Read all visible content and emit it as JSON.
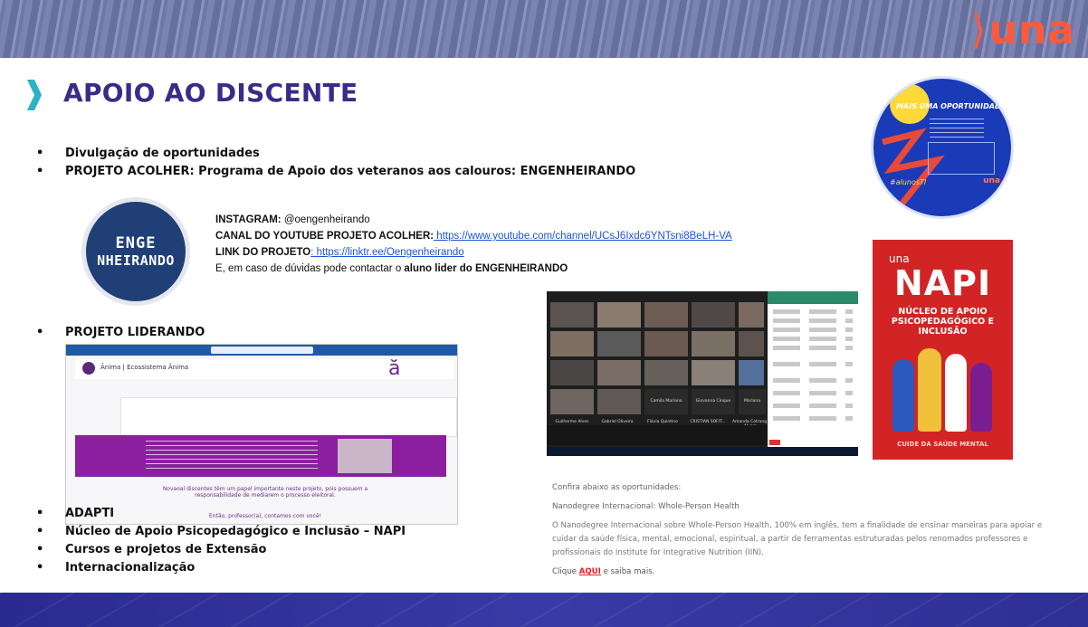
{
  "banner": {
    "logo_text": "una",
    "logo_accent": "#ff5a3c"
  },
  "title": {
    "text": "APOIO AO DISCENTE",
    "color": "#3b2a87"
  },
  "bullets_top": [
    "Divulgação de oportunidades",
    "PROJETO ACOLHER: Programa de Apoio dos veteranos aos calouros: ENGENHEIRANDO"
  ],
  "enge_logo": {
    "line1": "ENGE",
    "line2": "NHEIRANDO"
  },
  "info": {
    "instagram_label": "INSTAGRAM:",
    "instagram_value": " @oengenheirando",
    "youtube_label": "CANAL DO YOUTUBE PROJETO ACOLHER:",
    "youtube_link": " https://www.youtube.com/channel/UCsJ6Ixdc6YNTsni8BeLH-VA",
    "link_label": "LINK DO PROJETO",
    "link_value": ": https://linktr.ee/Oengenheirando",
    "contact_prefix": "E, em caso de dúvidas pode contactar o ",
    "contact_bold": "aluno lider do ENGENHEIRANDO"
  },
  "bullet_liderando": "PROJETO LIDERANDO",
  "bullets_bottom": [
    "ADAPTI",
    "Núcleo de Apoio Psicopedagógico e Inclusão – NAPI",
    "Cursos e projetos de Extensão",
    "Internacionalização"
  ],
  "liderando_shot": {
    "org_name": "Ânima | Ecossistema Ânima",
    "mark": "ă",
    "text1": "Novaoal discentes têm um papel importante neste projeto, pois possuem a responsabilidade de mediarem o processo eleitoral.",
    "text2": "Então, professor(a), contamos com você!"
  },
  "circle_poster": {
    "title": "MAIS UMA OPORTUNIDADE",
    "tag": "#alunosTI",
    "una": "una"
  },
  "napi_poster": {
    "una": "una",
    "title": "NAPI",
    "subtitle": "NÚCLEO DE APOIO PSICOPEDAGÓGICO E INCLUSÃO",
    "footer": "CUIDE DA SAÚDE MENTAL"
  },
  "meeting_shot": {
    "names": [
      "Camila Mariano",
      "Giovanna Cinque",
      "Mariana Alvare...",
      "Guilherme Alves",
      "Gabriel Oliveira",
      "Flávia Quintino",
      "CRISTIAN SOFIT...",
      "Amanda Cotrang"
    ]
  },
  "opportunities": {
    "heading": "Confira abaixo as oportunidades:",
    "subheading": "Nanodegree Internacional: Whole-Person Health",
    "body": "O Nanodegree Internacional sobre Whole-Person Health, 100% em inglês, tem a finalidade de ensinar maneiras para apoiar e cuidar da saúde física, mental, emocional, espiritual, a partir de ferramentas estruturadas pelos renomados professores e profissionais do Institute for Integrative Nutrition (IIN).",
    "cta_prefix": "Clique ",
    "cta_link": "AQUI",
    "cta_suffix": " e saiba mais."
  }
}
